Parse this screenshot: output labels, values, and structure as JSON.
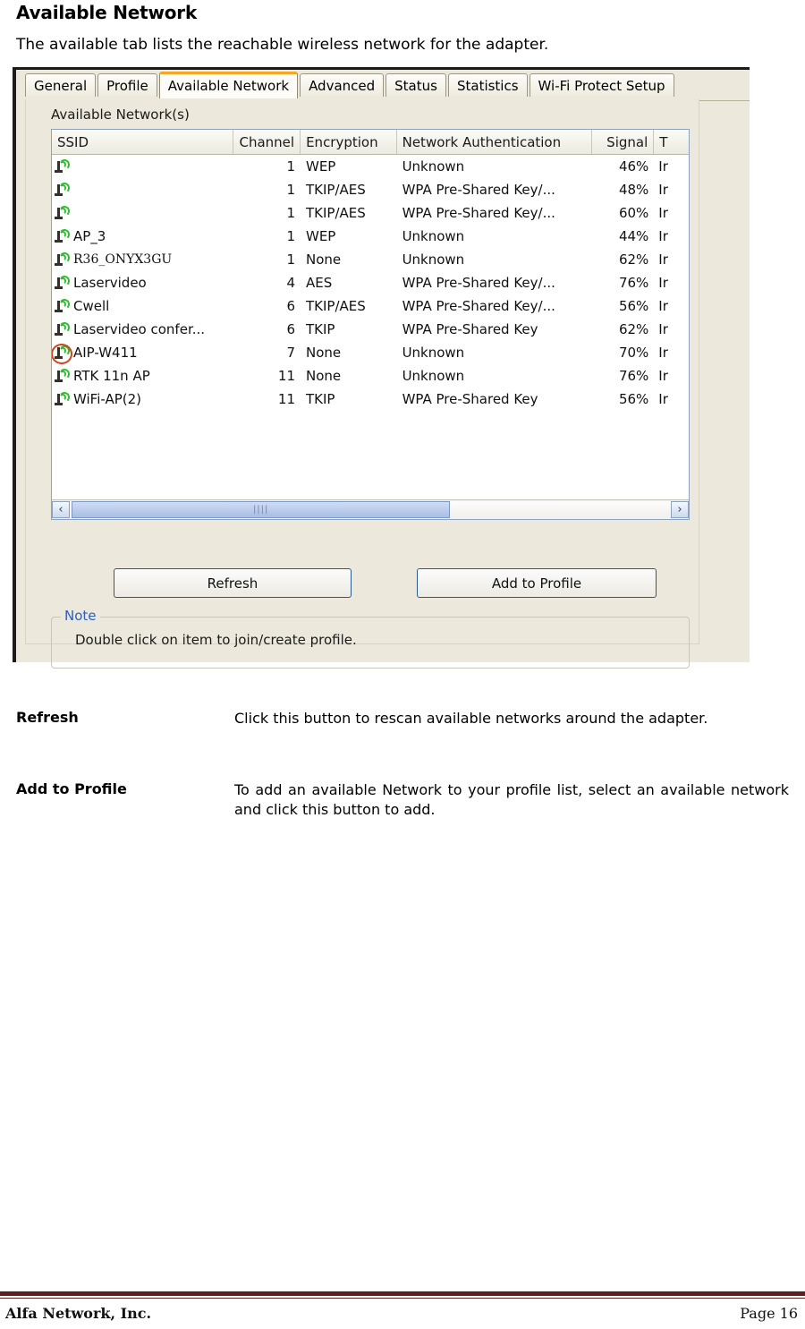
{
  "document": {
    "title": "Available Network",
    "intro": "The available tab lists the reachable wireless network for the adapter."
  },
  "app": {
    "tabs": [
      {
        "label": "General",
        "active": false
      },
      {
        "label": "Profile",
        "active": false
      },
      {
        "label": "Available Network",
        "active": true
      },
      {
        "label": "Advanced",
        "active": false
      },
      {
        "label": "Status",
        "active": false
      },
      {
        "label": "Statistics",
        "active": false
      },
      {
        "label": "Wi-Fi Protect Setup",
        "active": false
      }
    ],
    "group_label": "Available Network(s)",
    "table": {
      "columns": [
        "SSID",
        "Channel",
        "Encryption",
        "Network Authentication",
        "Signal",
        "T"
      ],
      "rows": [
        {
          "icon": "access-point-icon",
          "ssid": "",
          "channel": "1",
          "encryption": "WEP",
          "auth": "Unknown",
          "signal": "46%",
          "type": "Ir",
          "circled": false,
          "serif": false
        },
        {
          "icon": "access-point-icon",
          "ssid": "",
          "channel": "1",
          "encryption": "TKIP/AES",
          "auth": "WPA Pre-Shared Key/...",
          "signal": "48%",
          "type": "Ir",
          "circled": false,
          "serif": false
        },
        {
          "icon": "access-point-icon",
          "ssid": "",
          "channel": "1",
          "encryption": "TKIP/AES",
          "auth": "WPA Pre-Shared Key/...",
          "signal": "60%",
          "type": "Ir",
          "circled": false,
          "serif": false
        },
        {
          "icon": "access-point-icon",
          "ssid": "AP_3",
          "channel": "1",
          "encryption": "WEP",
          "auth": "Unknown",
          "signal": "44%",
          "type": "Ir",
          "circled": false,
          "serif": false
        },
        {
          "icon": "access-point-icon",
          "ssid": "R36_ONYX3GU",
          "channel": "1",
          "encryption": "None",
          "auth": "Unknown",
          "signal": "62%",
          "type": "Ir",
          "circled": false,
          "serif": true
        },
        {
          "icon": "access-point-icon",
          "ssid": "Laservideo",
          "channel": "4",
          "encryption": "AES",
          "auth": "WPA Pre-Shared Key/...",
          "signal": "76%",
          "type": "Ir",
          "circled": false,
          "serif": false
        },
        {
          "icon": "access-point-icon",
          "ssid": "Cwell",
          "channel": "6",
          "encryption": "TKIP/AES",
          "auth": "WPA Pre-Shared Key/...",
          "signal": "56%",
          "type": "Ir",
          "circled": false,
          "serif": false
        },
        {
          "icon": "access-point-icon",
          "ssid": "Laservideo confer...",
          "channel": "6",
          "encryption": "TKIP",
          "auth": "WPA Pre-Shared Key",
          "signal": "62%",
          "type": "Ir",
          "circled": false,
          "serif": false
        },
        {
          "icon": "access-point-icon",
          "ssid": "AIP-W411",
          "channel": "7",
          "encryption": "None",
          "auth": "Unknown",
          "signal": "70%",
          "type": "Ir",
          "circled": true,
          "serif": false
        },
        {
          "icon": "access-point-icon",
          "ssid": "RTK 11n AP",
          "channel": "11",
          "encryption": "None",
          "auth": "Unknown",
          "signal": "76%",
          "type": "Ir",
          "circled": false,
          "serif": false
        },
        {
          "icon": "access-point-icon",
          "ssid": "WiFi-AP(2)",
          "channel": "11",
          "encryption": "TKIP",
          "auth": "WPA Pre-Shared Key",
          "signal": "56%",
          "type": "Ir",
          "circled": false,
          "serif": false
        }
      ]
    },
    "scrollbar": {
      "left_arrow": "‹",
      "right_arrow": "›",
      "grip": "||||"
    },
    "buttons": {
      "refresh": "Refresh",
      "add_to_profile": "Add to Profile"
    },
    "note": {
      "legend": "Note",
      "text": "Double click on item to join/create profile."
    },
    "accent_color": "#f5a623",
    "note_legend_color": "#2b5fb8"
  },
  "descriptions": [
    {
      "term": "Refresh",
      "definition": "Click this button to rescan available networks around the adapter."
    },
    {
      "term": "Add to Profile",
      "definition": "To add an available Network to your profile list, select an available network and click this button to add."
    }
  ],
  "footer": {
    "company": "Alfa Network, Inc.",
    "page": "Page 16",
    "rule_color": "#5c1f1f"
  }
}
